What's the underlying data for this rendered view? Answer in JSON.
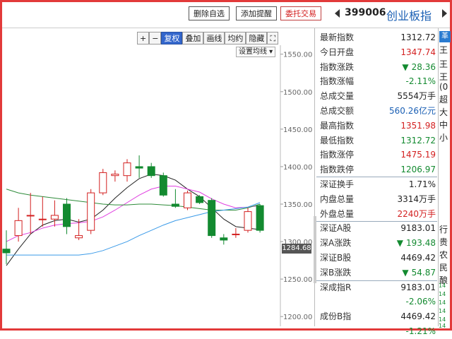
{
  "topbar": {
    "delete_watch": "删除自选",
    "add_alert": "添加提醒",
    "trade": "委托交易",
    "code": "399006",
    "name": "创业板指"
  },
  "toolbar": {
    "items": [
      "+",
      "−",
      "复权",
      "叠加",
      "画线",
      "均约",
      "隐藏",
      "⛶"
    ],
    "set_ma": "设置均线"
  },
  "chart_data": {
    "type": "candlestick",
    "y_ticks": [
      1550.0,
      1500.0,
      1450.0,
      1400.0,
      1350.0,
      1300.0,
      1250.0,
      1200.0
    ],
    "y_tick_labels": [
      "1550.00",
      "1500.00",
      "1450.00",
      "1400.00",
      "1350.00",
      "1300.00",
      "1250.00",
      "1200.00"
    ],
    "ylim": [
      1187,
      1562
    ],
    "current_price_label": "1284.68",
    "candles": [
      {
        "open": 1290,
        "close": 1285,
        "high": 1315,
        "low": 1270,
        "dir": "down"
      },
      {
        "open": 1308,
        "close": 1328,
        "high": 1345,
        "low": 1300,
        "dir": "up"
      },
      {
        "open": 1335,
        "close": 1335,
        "high": 1365,
        "low": 1310,
        "dir": "up"
      },
      {
        "open": 1330,
        "close": 1330,
        "high": 1360,
        "low": 1320,
        "dir": "up"
      },
      {
        "open": 1330,
        "close": 1335,
        "high": 1355,
        "low": 1320,
        "dir": "up"
      },
      {
        "open": 1350,
        "close": 1320,
        "high": 1358,
        "low": 1310,
        "dir": "down"
      },
      {
        "open": 1305,
        "close": 1308,
        "high": 1330,
        "low": 1302,
        "dir": "up"
      },
      {
        "open": 1315,
        "close": 1365,
        "high": 1370,
        "low": 1310,
        "dir": "up"
      },
      {
        "open": 1365,
        "close": 1392,
        "high": 1397,
        "low": 1362,
        "dir": "up"
      },
      {
        "open": 1388,
        "close": 1390,
        "high": 1395,
        "low": 1380,
        "dir": "up"
      },
      {
        "open": 1388,
        "close": 1405,
        "high": 1410,
        "low": 1380,
        "dir": "up"
      },
      {
        "open": 1400,
        "close": 1398,
        "high": 1415,
        "low": 1385,
        "dir": "down"
      },
      {
        "open": 1400,
        "close": 1388,
        "high": 1405,
        "low": 1385,
        "dir": "down"
      },
      {
        "open": 1388,
        "close": 1362,
        "high": 1392,
        "low": 1360,
        "dir": "down"
      },
      {
        "open": 1350,
        "close": 1347,
        "high": 1370,
        "low": 1345,
        "dir": "down"
      },
      {
        "open": 1345,
        "close": 1365,
        "high": 1368,
        "low": 1342,
        "dir": "up"
      },
      {
        "open": 1360,
        "close": 1352,
        "high": 1362,
        "low": 1350,
        "dir": "down"
      },
      {
        "open": 1355,
        "close": 1308,
        "high": 1358,
        "low": 1305,
        "dir": "down"
      },
      {
        "open": 1305,
        "close": 1302,
        "high": 1310,
        "low": 1296,
        "dir": "down"
      },
      {
        "open": 1310,
        "close": 1310,
        "high": 1318,
        "low": 1305,
        "dir": "up"
      },
      {
        "open": 1315,
        "close": 1340,
        "high": 1345,
        "low": 1312,
        "dir": "up"
      },
      {
        "open": 1348,
        "close": 1315,
        "high": 1350,
        "low": 1312,
        "dir": "down"
      }
    ],
    "ma_series": [
      {
        "color": "#222222",
        "values": [
          1268,
          1290,
          1310,
          1322,
          1328,
          1330,
          1326,
          1330,
          1342,
          1358,
          1372,
          1384,
          1390,
          1388,
          1382,
          1370,
          1360,
          1345,
          1330,
          1320,
          1318,
          1316
        ]
      },
      {
        "color": "#e040e0",
        "values": [
          1300,
          1308,
          1312,
          1318,
          1322,
          1324,
          1325,
          1327,
          1333,
          1342,
          1352,
          1362,
          1370,
          1374,
          1374,
          1370,
          1366,
          1357,
          1350,
          1345,
          1346,
          1348
        ]
      },
      {
        "color": "#2e8b3a",
        "values": [
          1370,
          1365,
          1362,
          1360,
          1358,
          1356,
          1354,
          1352,
          1350,
          1349,
          1349,
          1350,
          1350,
          1349,
          1348,
          1346,
          1344,
          1342,
          1342,
          1342,
          1345,
          1350
        ]
      },
      {
        "color": "#3a9ae8",
        "values": [
          1282,
          1282,
          1282,
          1282,
          1282,
          1282,
          1282,
          1284,
          1288,
          1294,
          1300,
          1308,
          1315,
          1322,
          1328,
          1332,
          1336,
          1340,
          1342,
          1344,
          1346,
          1352
        ]
      }
    ]
  },
  "info": {
    "rows": [
      {
        "label": "最新指数",
        "value": "1312.72",
        "color": "black",
        "arrow": ""
      },
      {
        "label": "今日开盘",
        "value": "1347.74",
        "color": "red",
        "arrow": ""
      },
      {
        "label": "指数涨跌",
        "value": "28.36",
        "color": "green",
        "arrow": "▼"
      },
      {
        "label": "指数涨幅",
        "value": "-2.11%",
        "color": "green",
        "arrow": ""
      },
      {
        "label": "总成交量",
        "value": "5554万手",
        "color": "black",
        "arrow": ""
      },
      {
        "label": "总成交额",
        "value": "560.26亿元",
        "color": "blue",
        "arrow": ""
      },
      {
        "label": "最高指数",
        "value": "1351.98",
        "color": "red",
        "arrow": ""
      },
      {
        "label": "最低指数",
        "value": "1312.72",
        "color": "green",
        "arrow": ""
      },
      {
        "label": "指数涨停",
        "value": "1475.19",
        "color": "red",
        "arrow": ""
      },
      {
        "label": "指数跌停",
        "value": "1206.97",
        "color": "green",
        "arrow": ""
      },
      {
        "label": "深证换手",
        "value": "1.71%",
        "color": "black",
        "arrow": ""
      },
      {
        "label": "内盘总量",
        "value": "3314万手",
        "color": "black",
        "arrow": ""
      },
      {
        "label": "外盘总量",
        "value": "2240万手",
        "color": "red",
        "arrow": ""
      },
      {
        "label": "深证A股",
        "value": "9183.01",
        "color": "black",
        "arrow": ""
      },
      {
        "label": "深A涨跌",
        "value": "193.48",
        "color": "green",
        "arrow": "▼"
      },
      {
        "label": "深证B股",
        "value": "4469.42",
        "color": "black",
        "arrow": ""
      },
      {
        "label": "深B涨跌",
        "value": "54.87",
        "color": "green",
        "arrow": "▼"
      },
      {
        "label": "深成指R",
        "value": "9183.01",
        "color": "black",
        "arrow": ""
      },
      {
        "label": "",
        "value": "-2.06%",
        "color": "green",
        "arrow": ""
      },
      {
        "label": "成份B指",
        "value": "4469.42",
        "color": "black",
        "arrow": ""
      },
      {
        "label": "",
        "value": "-1.21%",
        "color": "green",
        "arrow": ""
      }
    ]
  },
  "right_col": {
    "tab": "革",
    "chars": [
      "王",
      "王",
      "王",
      "(0",
      "超",
      "大",
      "中",
      "小",
      "行",
      "贵",
      "农",
      "民",
      "酿"
    ],
    "nums": [
      "14",
      "14",
      "14",
      "14",
      "14",
      "14"
    ]
  },
  "colors": {
    "up": "#d32020",
    "down": "#138a30",
    "frame": "#e23a3a"
  }
}
